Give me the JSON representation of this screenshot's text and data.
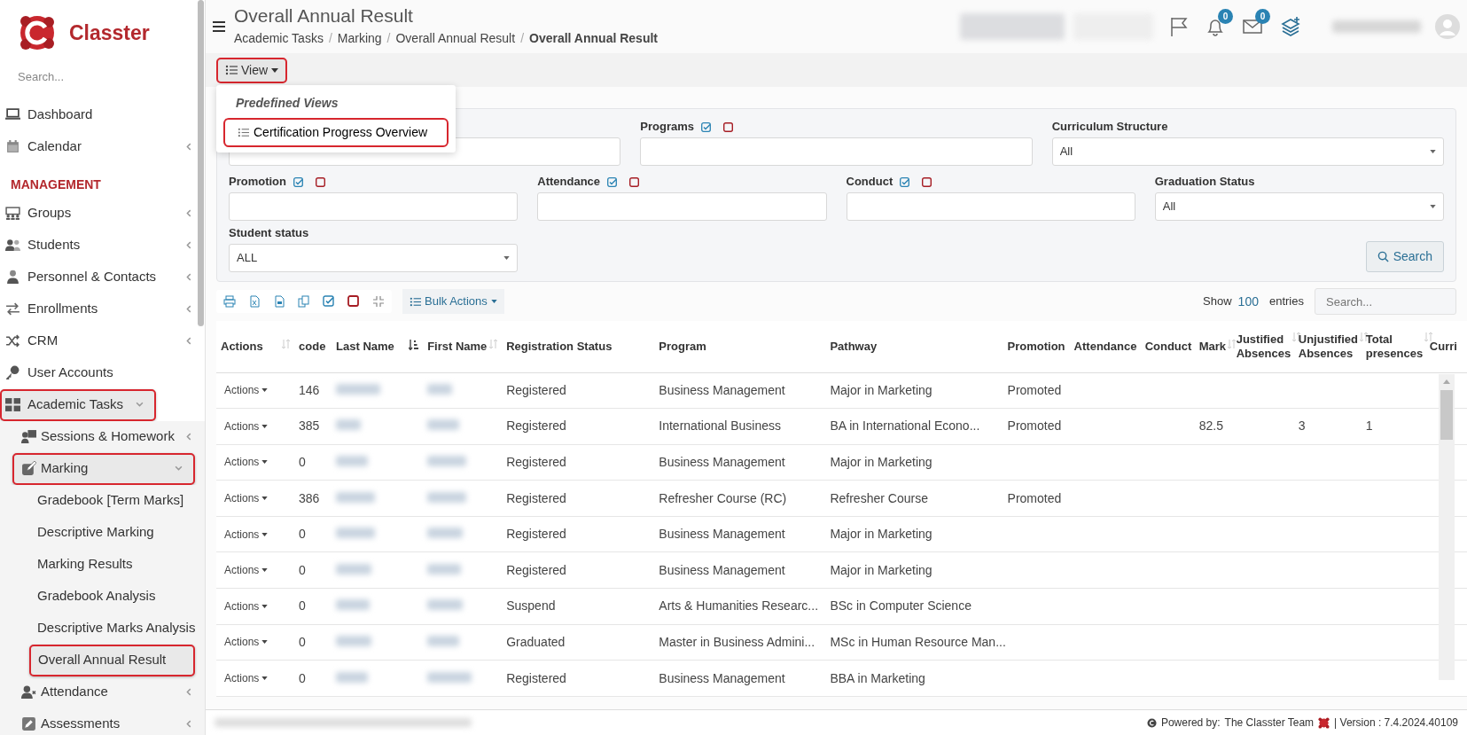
{
  "sidebar": {
    "logo": "Classter",
    "search": {
      "placeholder": "Search..."
    },
    "items": [
      {
        "kind": "link",
        "label": "Dashboard",
        "selected": false
      },
      {
        "kind": "link",
        "label": "Calendar",
        "selected": false,
        "expanded": false
      },
      {
        "kind": "header",
        "label": "MANAGEMENT"
      },
      {
        "kind": "link",
        "label": "Groups",
        "selected": false,
        "expanded": false
      },
      {
        "kind": "link",
        "label": "Students",
        "selected": false,
        "expanded": false
      },
      {
        "kind": "link",
        "label": "Personnel & Contacts",
        "selected": false,
        "expanded": false
      },
      {
        "kind": "link",
        "label": "Enrollments",
        "selected": false,
        "expanded": false
      },
      {
        "kind": "link",
        "label": "CRM",
        "selected": false,
        "expanded": false
      },
      {
        "kind": "link",
        "label": "User Accounts",
        "selected": false
      },
      {
        "kind": "link",
        "label": "Academic Tasks",
        "selected": true,
        "expanded": true,
        "children": [
          {
            "kind": "link",
            "label": "Sessions & Homework",
            "selected": false,
            "expanded": false
          },
          {
            "kind": "link",
            "label": "Marking",
            "selected": true,
            "expanded": true,
            "children": [
              {
                "kind": "link",
                "label": "Gradebook [Term Marks]",
                "selected": false
              },
              {
                "kind": "link",
                "label": "Descriptive Marking",
                "selected": false
              },
              {
                "kind": "link",
                "label": "Marking Results",
                "selected": false
              },
              {
                "kind": "link",
                "label": "Gradebook Analysis",
                "selected": false
              },
              {
                "kind": "link",
                "label": "Descriptive Marks Analysis",
                "selected": false
              },
              {
                "kind": "link",
                "label": "Overall Annual Result",
                "selected": true
              }
            ]
          },
          {
            "kind": "link",
            "label": "Attendance",
            "selected": false,
            "expanded": false
          },
          {
            "kind": "link",
            "label": "Assessments",
            "selected": false,
            "expanded": false
          }
        ]
      }
    ]
  },
  "header": {
    "title": "Overall Annual Result",
    "breadcrumbs": [
      {
        "label": "Academic Tasks",
        "separator": "/"
      },
      {
        "label": "Marking",
        "separator": "/"
      },
      {
        "label": "Overall Annual Result",
        "separator": "/"
      },
      {
        "label": "Overall Annual Result"
      }
    ],
    "notifications": "0",
    "messages": "0"
  },
  "view_menu": {
    "label": "View",
    "highlighted": true,
    "open": true,
    "section": "Predefined Views",
    "items": [
      {
        "label": "Certification Progress Overview",
        "highlighted": true
      }
    ]
  },
  "filters": [
    {
      "kind": "text"
    },
    {
      "kind": "text",
      "label": "Programs"
    },
    {
      "kind": "select",
      "label": "Curriculum Structure",
      "value": "All"
    },
    {
      "kind": "text",
      "label": "Promotion"
    },
    {
      "kind": "text",
      "label": "Attendance"
    },
    {
      "kind": "text",
      "label": "Conduct"
    },
    {
      "kind": "select",
      "label": "Graduation Status",
      "value": "All"
    },
    {
      "kind": "select",
      "label": "Student status",
      "value": "ALL"
    }
  ],
  "search_button": "Search",
  "toolbar": {
    "bulk_actions": "Bulk Actions",
    "show": "Show",
    "entries_count": "100",
    "entries": "entries",
    "search": {
      "placeholder": "Search..."
    }
  },
  "table": {
    "columns": [
      {
        "label": "Actions",
        "kind": "sortable"
      },
      {
        "label": "code",
        "kind": "plain"
      },
      {
        "label": "Last Name",
        "kind": "sorted"
      },
      {
        "label": "First Name",
        "kind": "sortable"
      },
      {
        "label": "Registration Status",
        "kind": "plain"
      },
      {
        "label": "Program",
        "kind": "plain"
      },
      {
        "label": "Pathway",
        "kind": "plain"
      },
      {
        "label": "Promotion",
        "kind": "plain"
      },
      {
        "label": "Attendance",
        "kind": "plain"
      },
      {
        "label": "Conduct",
        "kind": "plain"
      },
      {
        "label": "Mark",
        "kind": "sortable"
      },
      {
        "label": "Justified Absences",
        "kind": "sortable"
      },
      {
        "label": "Unjustified Absences",
        "kind": "sortable"
      },
      {
        "label": "Total presences",
        "kind": "sortable"
      },
      {
        "label": "Curri",
        "kind": "plain"
      }
    ],
    "rows": [
      {
        "cells": [
          {
            "kind": "action",
            "text": "Actions"
          },
          {
            "kind": "text",
            "text": "146"
          },
          {
            "kind": "redacted"
          },
          {
            "kind": "redacted"
          },
          {
            "kind": "text",
            "text": "Registered"
          },
          {
            "kind": "text",
            "text": "Business Management"
          },
          {
            "kind": "text",
            "text": "Major in Marketing"
          },
          {
            "kind": "text",
            "text": "Promoted"
          },
          null,
          null,
          null,
          null,
          null,
          null,
          null
        ]
      },
      {
        "cells": [
          {
            "kind": "action",
            "text": "Actions"
          },
          {
            "kind": "text",
            "text": "385"
          },
          {
            "kind": "redacted"
          },
          {
            "kind": "redacted"
          },
          {
            "kind": "text",
            "text": "Registered"
          },
          {
            "kind": "text",
            "text": "International Business"
          },
          {
            "kind": "link",
            "text": "BA in International Econo..."
          },
          {
            "kind": "text",
            "text": "Promoted"
          },
          null,
          null,
          {
            "kind": "text",
            "text": "82.5"
          },
          null,
          {
            "kind": "text",
            "text": "3"
          },
          {
            "kind": "text",
            "text": "1"
          },
          null
        ]
      },
      {
        "cells": [
          {
            "kind": "action",
            "text": "Actions"
          },
          {
            "kind": "text",
            "text": "0"
          },
          {
            "kind": "redacted"
          },
          {
            "kind": "redacted"
          },
          {
            "kind": "text",
            "text": "Registered"
          },
          {
            "kind": "text",
            "text": "Business Management"
          },
          {
            "kind": "text",
            "text": "Major in Marketing"
          },
          null,
          null,
          null,
          null,
          null,
          null,
          null,
          null
        ]
      },
      {
        "cells": [
          {
            "kind": "action",
            "text": "Actions"
          },
          {
            "kind": "text",
            "text": "386"
          },
          {
            "kind": "redacted"
          },
          {
            "kind": "redacted"
          },
          {
            "kind": "text",
            "text": "Registered"
          },
          {
            "kind": "text",
            "text": "Refresher Course (RC)"
          },
          {
            "kind": "text",
            "text": "Refresher Course"
          },
          {
            "kind": "text",
            "text": "Promoted"
          },
          null,
          null,
          null,
          null,
          null,
          null,
          null
        ]
      },
      {
        "cells": [
          {
            "kind": "action",
            "text": "Actions"
          },
          {
            "kind": "text",
            "text": "0"
          },
          {
            "kind": "redacted"
          },
          {
            "kind": "redacted"
          },
          {
            "kind": "text",
            "text": "Registered"
          },
          {
            "kind": "text",
            "text": "Business Management"
          },
          {
            "kind": "text",
            "text": "Major in Marketing"
          },
          null,
          null,
          null,
          null,
          null,
          null,
          null,
          null
        ]
      },
      {
        "cells": [
          {
            "kind": "action",
            "text": "Actions"
          },
          {
            "kind": "text",
            "text": "0"
          },
          {
            "kind": "redacted"
          },
          {
            "kind": "redacted"
          },
          {
            "kind": "text",
            "text": "Registered"
          },
          {
            "kind": "text",
            "text": "Business Management"
          },
          {
            "kind": "text",
            "text": "Major in Marketing"
          },
          null,
          null,
          null,
          null,
          null,
          null,
          null,
          null
        ]
      },
      {
        "cells": [
          {
            "kind": "action",
            "text": "Actions"
          },
          {
            "kind": "text",
            "text": "0"
          },
          {
            "kind": "redacted"
          },
          {
            "kind": "redacted"
          },
          {
            "kind": "text",
            "text": "Suspend"
          },
          {
            "kind": "link",
            "text": "Arts & Humanities Researc..."
          },
          {
            "kind": "text",
            "text": "BSc in Computer Science"
          },
          null,
          null,
          null,
          null,
          null,
          null,
          null,
          null
        ]
      },
      {
        "cells": [
          {
            "kind": "action",
            "text": "Actions"
          },
          {
            "kind": "text",
            "text": "0"
          },
          {
            "kind": "redacted"
          },
          {
            "kind": "redacted"
          },
          {
            "kind": "text",
            "text": "Graduated"
          },
          {
            "kind": "link",
            "text": "Master in Business Admini..."
          },
          {
            "kind": "link",
            "text": "MSc in Human Resource Man..."
          },
          null,
          null,
          null,
          null,
          null,
          null,
          null,
          null
        ]
      },
      {
        "cells": [
          {
            "kind": "action",
            "text": "Actions"
          },
          {
            "kind": "text",
            "text": "0"
          },
          {
            "kind": "redacted"
          },
          {
            "kind": "redacted"
          },
          {
            "kind": "text",
            "text": "Registered"
          },
          {
            "kind": "text",
            "text": "Business Management"
          },
          {
            "kind": "text",
            "text": "BBA in Marketing"
          },
          null,
          null,
          null,
          null,
          null,
          null,
          null,
          null
        ]
      }
    ]
  },
  "footer": {
    "powered_by": "Powered by:",
    "team": "The Classter Team",
    "version": "| Version : 7.4.2024.40109"
  }
}
